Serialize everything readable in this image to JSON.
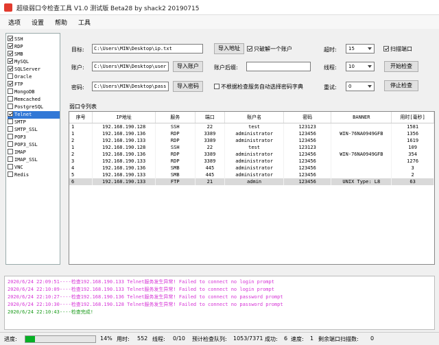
{
  "window": {
    "title": "超级弱口令检查工具 V1.0 测试版 Beta28 by shack2 20190715"
  },
  "menu": [
    "选项",
    "设置",
    "帮助",
    "工具"
  ],
  "modules": [
    {
      "name": "SSH",
      "checked": true
    },
    {
      "name": "RDP",
      "checked": true
    },
    {
      "name": "SMB",
      "checked": true
    },
    {
      "name": "MySQL",
      "checked": true
    },
    {
      "name": "SQLServer",
      "checked": true
    },
    {
      "name": "Oracle",
      "checked": false
    },
    {
      "name": "FTP",
      "checked": true
    },
    {
      "name": "MongoDB",
      "checked": false
    },
    {
      "name": "Memcached",
      "checked": false
    },
    {
      "name": "PostgreSQL",
      "checked": false
    },
    {
      "name": "Telnet",
      "checked": true
    },
    {
      "name": "SMTP",
      "checked": false
    },
    {
      "name": "SMTP_SSL",
      "checked": false
    },
    {
      "name": "POP3",
      "checked": false
    },
    {
      "name": "POP3_SSL",
      "checked": false
    },
    {
      "name": "IMAP",
      "checked": false
    },
    {
      "name": "IMAP_SSL",
      "checked": false
    },
    {
      "name": "VNC",
      "checked": false
    },
    {
      "name": "Redis",
      "checked": false
    }
  ],
  "form": {
    "target_label": "目标:",
    "target_value": "C:\\Users\\MIN\\Desktop\\ip.txt",
    "import_target_btn": "导入地址",
    "only_one_label": "只破解一个账户",
    "timeout_label": "超时:",
    "timeout_value": "15",
    "scan_port_label": "扫描端口",
    "account_label": "账户:",
    "account_value": "C:\\Users\\MIN\\Desktop\\user",
    "import_account_btn": "导入账户",
    "suffix_label": "账户后缀:",
    "suffix_value": "",
    "threads_label": "线程:",
    "threads_value": "10",
    "start_btn": "开始检查",
    "password_label": "密码:",
    "password_value": "C:\\Users\\MIN\\Desktop\\pass",
    "import_password_btn": "导入密码",
    "auto_dict_label": "不根据检查服务自动选择密码字典",
    "retry_label": "重试:",
    "retry_value": "0",
    "stop_btn": "停止检查"
  },
  "results": {
    "group_title": "弱口令列表",
    "columns": [
      "序号",
      "IP地址",
      "服务",
      "端口",
      "账户名",
      "密码",
      "BANNER",
      "用时[毫秒]"
    ],
    "rows": [
      [
        "1",
        "192.168.190.128",
        "SSH",
        "22",
        "test",
        "123123",
        "",
        "1581"
      ],
      [
        "1",
        "192.168.190.136",
        "RDP",
        "3389",
        "administrator",
        "123456",
        "WIN-76NA0949GFB",
        "1356"
      ],
      [
        "2",
        "192.168.190.133",
        "RDP",
        "3389",
        "administrator",
        "123456",
        "",
        "1619"
      ],
      [
        "1",
        "192.168.190.128",
        "SSH",
        "22",
        "test",
        "123123",
        "",
        "109"
      ],
      [
        "2",
        "192.168.190.136",
        "RDP",
        "3389",
        "administrator",
        "123456",
        "WIN-76NA0949GFB",
        "354"
      ],
      [
        "3",
        "192.168.190.133",
        "RDP",
        "3389",
        "administrator",
        "123456",
        "",
        "1276"
      ],
      [
        "4",
        "192.168.190.136",
        "SMB",
        "445",
        "administrator",
        "123456",
        "",
        "3"
      ],
      [
        "5",
        "192.168.190.133",
        "SMB",
        "445",
        "administrator",
        "123456",
        "",
        "2"
      ],
      [
        "6",
        "192.168.190.133",
        "FTP",
        "21",
        "admin",
        "123456",
        "UNIX Type: L8",
        "63"
      ]
    ]
  },
  "log": [
    {
      "text": "2020/6/24 22:09:51----检查192.168.190.133 Telnet服务发生异常! Failed to connect   no login prompt",
      "color": "#d633d6"
    },
    {
      "text": "2020/6/24 22:10:09----检查192.168.190.133 Telnet服务发生异常! Failed to connect   no login prompt",
      "color": "#d633d6"
    },
    {
      "text": "2020/6/24 22:10:27----检查192.168.190.136 Telnet服务发生异常! Failed to connect   no password prompt",
      "color": "#d633d6"
    },
    {
      "text": "2020/6/24 22:10:30----检查192.168.190.128 Telnet服务发生异常! Failed to connect   no password prompt",
      "color": "#d633d6"
    },
    {
      "text": "2020/6/24 22:10:43----检查完成!",
      "color": "#1a9a1a"
    }
  ],
  "status": {
    "progress_label": "进度:",
    "progress_pct": 14,
    "progress_text": "14%",
    "elapsed_label": "用时:",
    "elapsed_value": "552",
    "threads_label": "线程:",
    "threads_value": "0/10",
    "queue_label": "预计检查队列:",
    "queue_value": "1053/7371",
    "success_label": "成功:",
    "success_value": "6",
    "speed_label": "速度:",
    "speed_value": "1",
    "remaining_label": "剩余端口扫描数:",
    "remaining_value": "0"
  },
  "colors": {
    "selection": "#3278d6",
    "progress": "#06b025",
    "log_error": "#d633d6",
    "log_ok": "#1a9a1a"
  }
}
